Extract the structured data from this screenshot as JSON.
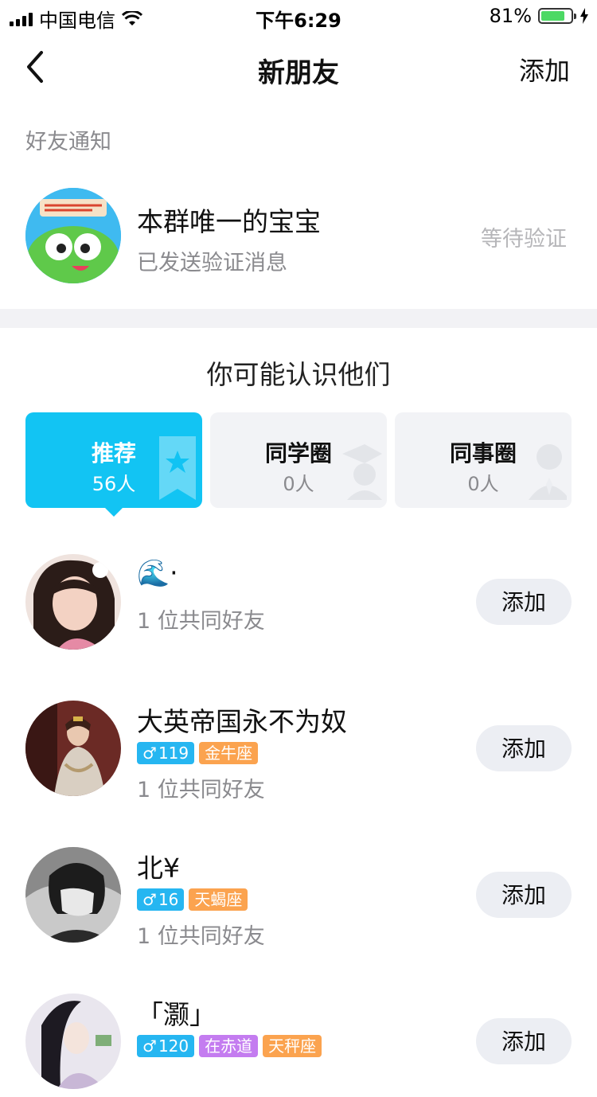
{
  "status_bar": {
    "carrier": "中国电信",
    "time": "下午6:29",
    "battery": "81%",
    "battery_level": 0.81
  },
  "nav": {
    "title": "新朋友",
    "add_label": "添加"
  },
  "notifications": {
    "section_label": "好友通知",
    "item": {
      "name": "本群唯一的宝宝",
      "sub": "已发送验证消息",
      "status": "等待验证"
    }
  },
  "suggestions": {
    "title": "你可能认识他们",
    "tabs": [
      {
        "label": "推荐",
        "count": "56人"
      },
      {
        "label": "同学圈",
        "count": "0人"
      },
      {
        "label": "同事圈",
        "count": "0人"
      }
    ],
    "people": [
      {
        "name": "🌊·",
        "mutual": "1 位共同好友",
        "add_label": "添加"
      },
      {
        "name": "大英帝国永不为奴",
        "gender_age": "119",
        "tags": [
          "金牛座"
        ],
        "mutual": "1 位共同好友",
        "add_label": "添加"
      },
      {
        "name": "北¥",
        "gender_age": "16",
        "tags": [
          "天蝎座"
        ],
        "mutual": "1 位共同好友",
        "add_label": "添加"
      },
      {
        "name": "「灏」",
        "gender_age": "120",
        "tags": [
          "在赤道",
          "天秤座"
        ],
        "add_label": "添加"
      }
    ]
  },
  "colors": {
    "accent": "#12c4f3",
    "gender_tag": "#26b6f1",
    "zodiac_tag": "#fba34f",
    "location_tag": "#c47cf0"
  }
}
